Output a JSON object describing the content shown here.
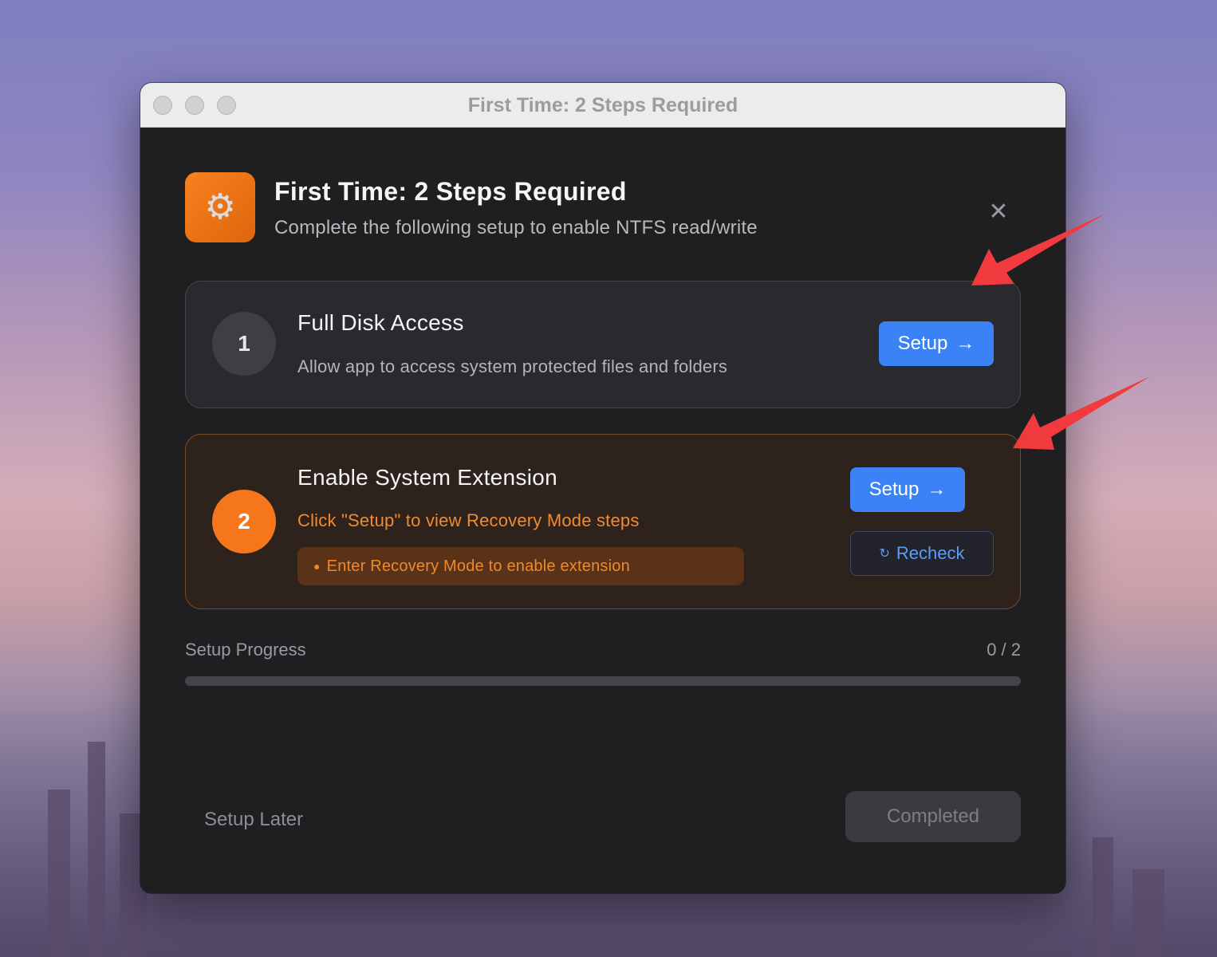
{
  "window": {
    "title": "First Time: 2 Steps Required"
  },
  "header": {
    "icon": "gear-icon",
    "title": "First Time: 2 Steps Required",
    "subtitle": "Complete the following setup to enable NTFS read/write",
    "close_icon": "close-icon"
  },
  "steps": [
    {
      "number": "1",
      "title": "Full Disk Access",
      "description": "Allow app to access system protected files and folders",
      "setup_label": "Setup",
      "setup_arrow": "→"
    },
    {
      "number": "2",
      "title": "Enable System Extension",
      "description": "Click \"Setup\" to view Recovery Mode steps",
      "hint": "Enter Recovery Mode to enable extension",
      "setup_label": "Setup",
      "setup_arrow": "→",
      "recheck_label": "Recheck",
      "recheck_icon": "↻"
    }
  ],
  "progress": {
    "label": "Setup Progress",
    "count": "0 / 2",
    "fraction": 0
  },
  "footer": {
    "later_label": "Setup Later",
    "completed_label": "Completed"
  },
  "colors": {
    "accent_blue": "#3b82f6",
    "accent_orange": "#f5761b",
    "annotation_red": "#f03a3e"
  }
}
